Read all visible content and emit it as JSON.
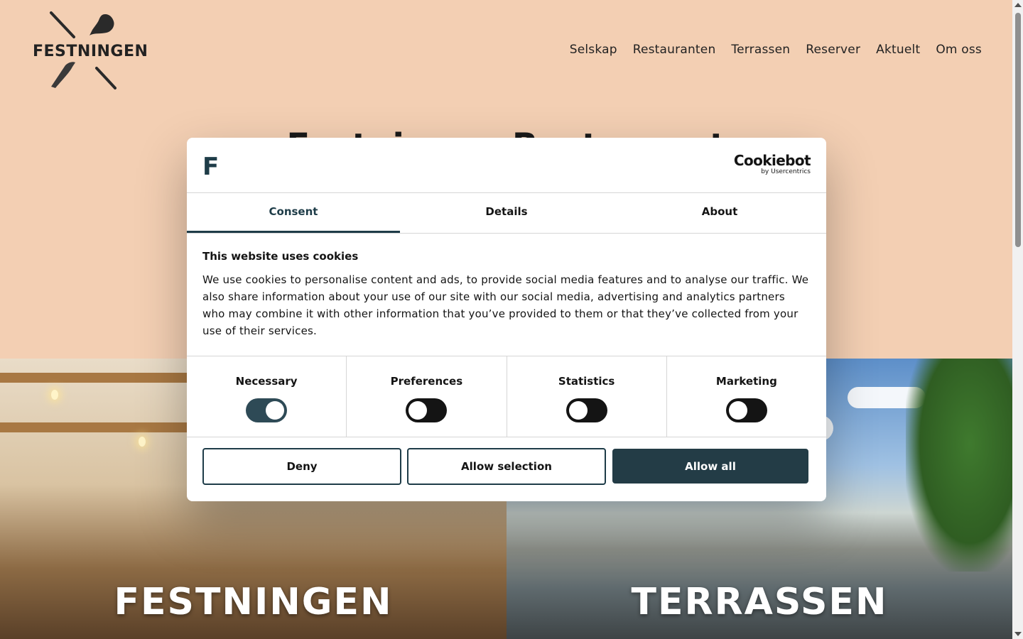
{
  "header": {
    "logo_text": "FESTNINGEN",
    "nav": [
      "Selskap",
      "Restauranten",
      "Terrassen",
      "Reserver",
      "Aktuelt",
      "Om oss"
    ]
  },
  "hero": {
    "title": "Festningen Restaurant"
  },
  "tiles": [
    {
      "label": "FESTNINGEN"
    },
    {
      "label": "TERRASSEN"
    }
  ],
  "cookie_dialog": {
    "brand_letter": "F",
    "provider_name": "Cookiebot",
    "provider_sub": "by Usercentrics",
    "tabs": [
      {
        "label": "Consent",
        "active": true
      },
      {
        "label": "Details",
        "active": false
      },
      {
        "label": "About",
        "active": false
      }
    ],
    "title": "This website uses cookies",
    "text": "We use cookies to personalise content and ads, to provide social media features and to analyse our traffic. We also share information about your use of our site with our social media, advertising and analytics partners who may combine it with other information that you’ve provided to them or that they’ve collected from your use of their services.",
    "toggles": [
      {
        "label": "Necessary",
        "on": true
      },
      {
        "label": "Preferences",
        "on": false
      },
      {
        "label": "Statistics",
        "on": false
      },
      {
        "label": "Marketing",
        "on": false
      }
    ],
    "buttons": {
      "deny": "Deny",
      "allow_selection": "Allow selection",
      "allow_all": "Allow all"
    },
    "colors": {
      "accent": "#233c46",
      "page_bg": "#f3cfb3"
    }
  }
}
